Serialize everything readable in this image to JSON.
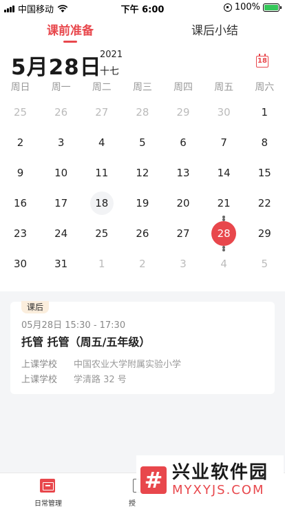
{
  "status_bar": {
    "carrier": "中国移动",
    "time": "下午 6:00",
    "battery": "100%"
  },
  "tabs": [
    {
      "label": "课前准备",
      "active": true
    },
    {
      "label": "课后小结",
      "active": false
    }
  ],
  "calendar": {
    "date_title": "5月28日",
    "year": "2021",
    "lunar": "十七",
    "today_icon_label": "18",
    "weekdays": [
      "周日",
      "周一",
      "周二",
      "周三",
      "周四",
      "周五",
      "周六"
    ],
    "weeks": [
      [
        {
          "d": "25",
          "muted": true
        },
        {
          "d": "26",
          "muted": true
        },
        {
          "d": "27",
          "muted": true
        },
        {
          "d": "28",
          "muted": true
        },
        {
          "d": "29",
          "muted": true
        },
        {
          "d": "30",
          "muted": true
        },
        {
          "d": "1"
        }
      ],
      [
        {
          "d": "2"
        },
        {
          "d": "3"
        },
        {
          "d": "4"
        },
        {
          "d": "5"
        },
        {
          "d": "6"
        },
        {
          "d": "7"
        },
        {
          "d": "8"
        }
      ],
      [
        {
          "d": "9"
        },
        {
          "d": "10"
        },
        {
          "d": "11"
        },
        {
          "d": "12"
        },
        {
          "d": "13"
        },
        {
          "d": "14"
        },
        {
          "d": "15"
        }
      ],
      [
        {
          "d": "16"
        },
        {
          "d": "17"
        },
        {
          "d": "18",
          "today": true
        },
        {
          "d": "19"
        },
        {
          "d": "20"
        },
        {
          "d": "21",
          "dot_below": true
        },
        {
          "d": "22"
        }
      ],
      [
        {
          "d": "23"
        },
        {
          "d": "24"
        },
        {
          "d": "25"
        },
        {
          "d": "26"
        },
        {
          "d": "27"
        },
        {
          "d": "28",
          "selected": true,
          "dot_above": true,
          "dot_below": true
        },
        {
          "d": "29"
        }
      ],
      [
        {
          "d": "30"
        },
        {
          "d": "31"
        },
        {
          "d": "1",
          "muted": true
        },
        {
          "d": "2",
          "muted": true
        },
        {
          "d": "3",
          "muted": true
        },
        {
          "d": "4",
          "muted": true,
          "dot_above": true
        },
        {
          "d": "5",
          "muted": true
        }
      ]
    ]
  },
  "lesson_card": {
    "badge": "课后",
    "time": "05月28日 15:30 - 17:30",
    "title": "托管 托管（周五/五年级）",
    "rows": [
      {
        "key": "上课学校",
        "value": "中国农业大学附属实验小学"
      },
      {
        "key": "上课学校",
        "value": "学清路 32 号"
      }
    ]
  },
  "bottom_nav": {
    "daily_label": "日常管理",
    "teach_label": "授"
  },
  "watermark": {
    "logo_glyph": "#",
    "title": "兴业软件园",
    "url": "MYXYJS.COM"
  },
  "colors": {
    "accent": "#e8474c",
    "muted_text": "#999999",
    "badge_bg": "#fbeedd"
  },
  "icons": {
    "today": "calendar-today-icon",
    "daily": "daily-management-icon",
    "teach": "teaching-icon"
  }
}
